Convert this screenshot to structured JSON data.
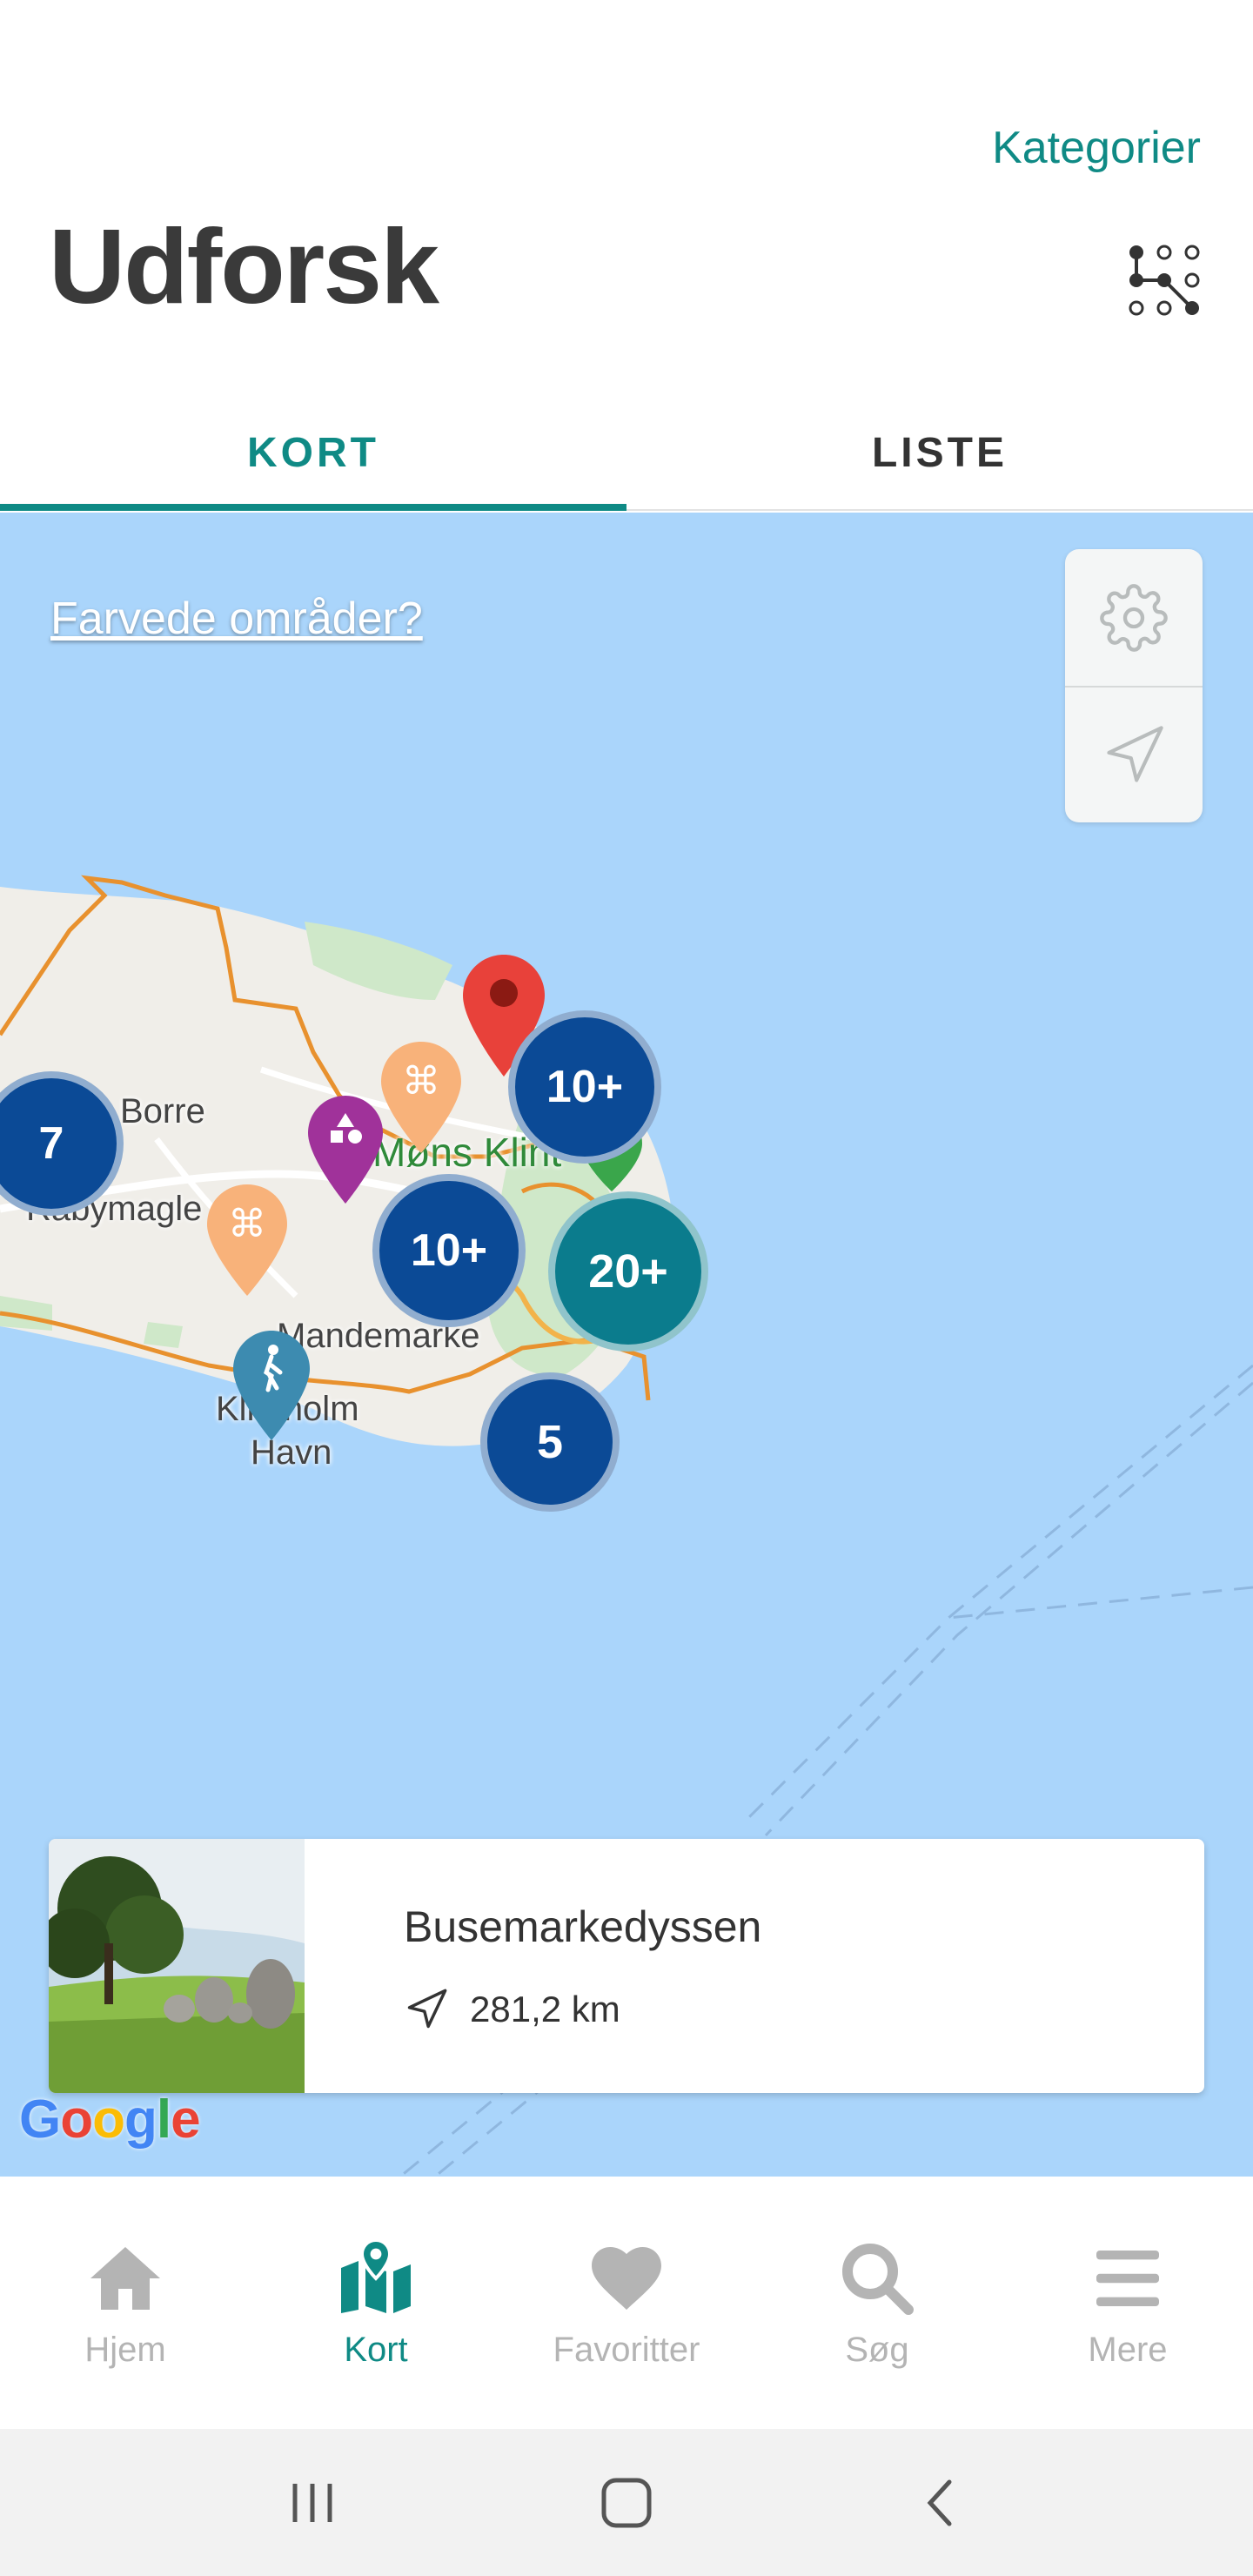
{
  "header": {
    "categories_label": "Kategorier",
    "title": "Udforsk",
    "category_icon": "category-tree-icon"
  },
  "tabs": [
    {
      "label": "KORT",
      "active": true
    },
    {
      "label": "LISTE",
      "active": false
    }
  ],
  "map": {
    "colored_areas_link": "Farvede områder?",
    "controls": [
      "settings-icon",
      "locate-icon"
    ],
    "labels": {
      "borre": "Borre",
      "rabymagle": "Rabymagle",
      "mons_klint": "Møns Klint",
      "mandemarke": "Mandemarke",
      "klintholm": "Klintholm",
      "havn": "Havn"
    },
    "clusters": {
      "c1": "7",
      "c2": "10+",
      "c3": "10+",
      "c4": "20+",
      "c5": "5"
    },
    "google_logo": "Google",
    "colors": {
      "water": "#aad5fb",
      "land": "#f0eee9",
      "cluster_dark": "#0b4a96",
      "cluster_teal": "#0b7c8d",
      "accent": "#0f8a85"
    }
  },
  "place_card": {
    "name": "Busemarkedyssen",
    "distance": "281,2 km"
  },
  "bottom_nav": [
    {
      "label": "Hjem",
      "icon": "home-icon",
      "active": false
    },
    {
      "label": "Kort",
      "icon": "map-pin-icon",
      "active": true
    },
    {
      "label": "Favoritter",
      "icon": "heart-icon",
      "active": false
    },
    {
      "label": "Søg",
      "icon": "search-icon",
      "active": false
    },
    {
      "label": "Mere",
      "icon": "menu-icon",
      "active": false
    }
  ]
}
